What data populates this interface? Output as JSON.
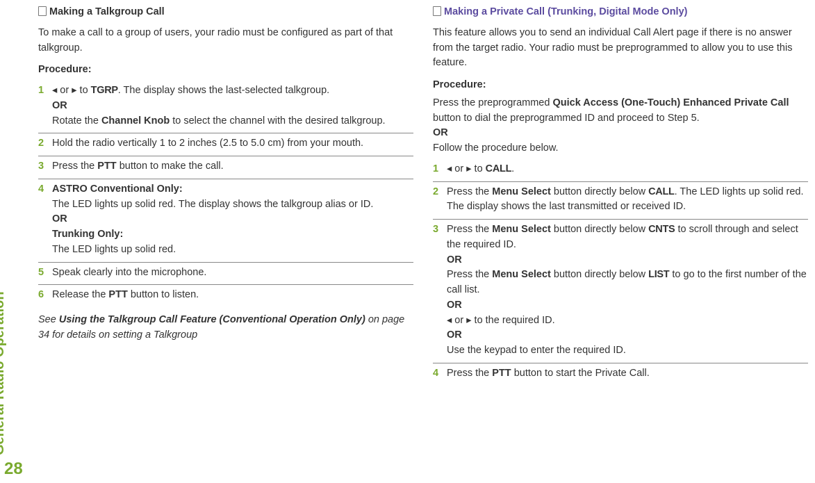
{
  "sidebar": {
    "label": "General Radio Operation",
    "pageNumber": "28"
  },
  "left": {
    "title": "Making a Talkgroup Call",
    "intro": "To make a call to a group of users, your radio must be configured as part of that talkgroup.",
    "procedureLabel": "Procedure:",
    "steps": {
      "s1": {
        "num": "1",
        "pre": "◂ or ▸ to ",
        "tgrp": "TGRP",
        "post": ". The display shows the last-selected talkgroup.",
        "or": "OR",
        "alt1": "Rotate the ",
        "bold1": "Channel Knob",
        "alt2": " to select the channel with the desired talkgroup."
      },
      "s2": {
        "num": "2",
        "text": "Hold the radio vertically 1 to 2 inches (2.5 to 5.0 cm) from your mouth."
      },
      "s3": {
        "num": "3",
        "pre": "Press the ",
        "bold": "PTT",
        "post": " button to make the call."
      },
      "s4": {
        "num": "4",
        "h1": "ASTRO Conventional Only:",
        "t1": "The LED lights up solid red. The display shows the talkgroup alias or ID.",
        "or": "OR",
        "h2": "Trunking Only:",
        "t2": "The LED lights up solid red."
      },
      "s5": {
        "num": "5",
        "text": "Speak clearly into the microphone."
      },
      "s6": {
        "num": "6",
        "pre": "Release the ",
        "bold": "PTT",
        "post": " button to listen."
      }
    },
    "footnote": {
      "pre": "See ",
      "bold": "Using the Talkgroup Call Feature (Conventional Operation Only)",
      "post": " on page 34 for details on setting a Talkgroup"
    }
  },
  "right": {
    "title": "Making a Private Call (Trunking, Digital Mode Only)",
    "intro": "This feature allows you to send an individual Call Alert page if there is no answer from the target radio. Your radio must be preprogrammed to allow you to use this feature.",
    "procedureLabel": "Procedure:",
    "preamble": {
      "t1a": "Press the preprogrammed ",
      "t1b": "Quick Access (One-Touch) Enhanced Private Call",
      "t1c": " button to dial the preprogrammed ID and proceed to Step 5.",
      "or": "OR",
      "t2": "Follow the procedure below."
    },
    "steps": {
      "s1": {
        "num": "1",
        "pre": "◂ or ▸ to ",
        "mono": "CALL",
        "post": "."
      },
      "s2": {
        "num": "2",
        "pre": "Press the ",
        "bold": "Menu Select",
        "mid": " button directly below ",
        "mono": "CALL",
        "post": ". The LED lights up solid red. The display shows the last transmitted or received ID."
      },
      "s3": {
        "num": "3",
        "line1": {
          "pre": "Press the ",
          "bold": "Menu Select",
          "mid": " button directly below ",
          "mono": "CNTS",
          "post": " to scroll through and select the required ID."
        },
        "or1": "OR",
        "line2": {
          "pre": "Press the ",
          "bold": "Menu Select",
          "mid": " button directly below ",
          "mono": "LIST",
          "post": " to go to the first number of the call list."
        },
        "or2": "OR",
        "line3": "◂ or ▸ to the required ID.",
        "or3": "OR",
        "line4": "Use the keypad to enter the required ID."
      },
      "s4": {
        "num": "4",
        "pre": "Press the ",
        "bold": "PTT",
        "post": " button to start the Private Call."
      }
    }
  }
}
